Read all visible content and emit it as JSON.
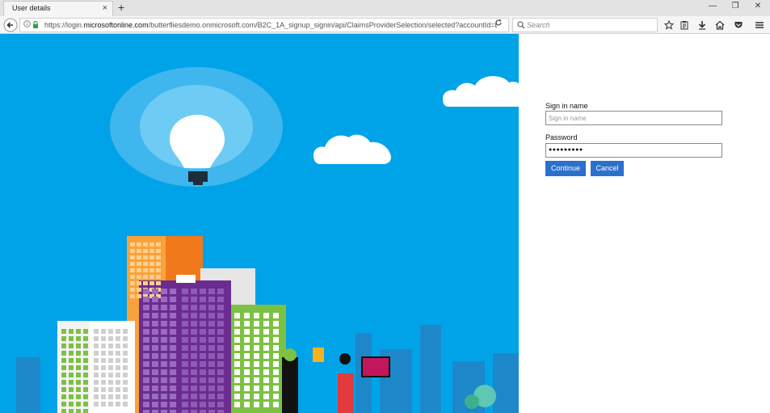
{
  "browser": {
    "tab_title": "User details",
    "tab_close": "×",
    "new_tab": "+",
    "url_prefix": "https://login.",
    "url_domain": "microsoftonline.com",
    "url_rest": "/butterfliesdemo.onmicrosoft.com/B2C_1A_signup_signin/api/ClaimsProviderSelection/selected?accountId=Lo",
    "search_placeholder": "Search",
    "window_controls": {
      "minimize": "—",
      "restore": "❐",
      "close": "✕"
    }
  },
  "form": {
    "signin_label": "Sign in name",
    "signin_placeholder": "Sign in name",
    "signin_value": "",
    "password_label": "Password",
    "password_value": "●●●●●●●●●",
    "continue_label": "Continue",
    "cancel_label": "Cancel"
  },
  "colors": {
    "background_sky": "#00a3e8",
    "button_blue": "#2b70cc"
  },
  "icons": [
    "back-arrow-icon",
    "info-icon",
    "lock-icon",
    "reload-icon",
    "search-icon",
    "star-icon",
    "reading-list-icon",
    "download-icon",
    "home-icon",
    "pocket-icon",
    "menu-icon"
  ]
}
